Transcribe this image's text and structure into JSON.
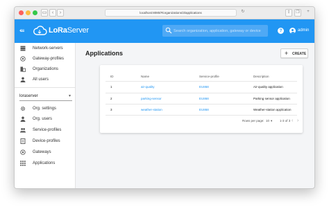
{
  "browser": {
    "url": "localhost:8080/#/organizations/3/applications"
  },
  "appbar": {
    "brand_bold": "LoRa",
    "brand_light": "Server",
    "search_placeholder": "Search organization, application, gateway or device",
    "user": "admin"
  },
  "sidebar": {
    "top_items": [
      {
        "label": "Network-servers",
        "icon": "server-icon"
      },
      {
        "label": "Gateway-profiles",
        "icon": "radio-tower-icon"
      },
      {
        "label": "Organizations",
        "icon": "domain-icon"
      },
      {
        "label": "All users",
        "icon": "person-icon"
      }
    ],
    "org_select": "loraserver",
    "org_items": [
      {
        "label": "Org. settings",
        "icon": "gear-icon"
      },
      {
        "label": "Org. users",
        "icon": "person-icon"
      },
      {
        "label": "Service-profiles",
        "icon": "people-icon"
      },
      {
        "label": "Device-profiles",
        "icon": "document-icon"
      },
      {
        "label": "Gateways",
        "icon": "radio-tower-icon"
      },
      {
        "label": "Applications",
        "icon": "apps-grid-icon"
      }
    ]
  },
  "main": {
    "title": "Applications",
    "create_label": "CREATE",
    "table": {
      "headers": [
        "ID",
        "Name",
        "Service-profile",
        "Description"
      ],
      "rows": [
        {
          "id": "1",
          "name": "air-quality",
          "service_profile": "EU868",
          "description": "Air-quality application"
        },
        {
          "id": "2",
          "name": "parking-sensor",
          "service_profile": "EU868",
          "description": "Parking sensor application"
        },
        {
          "id": "3",
          "name": "weather-station",
          "service_profile": "EU868",
          "description": "Weather-station application"
        }
      ]
    },
    "pagination": {
      "rows_per_page_label": "Rows per page:",
      "rows_per_page": "10",
      "range": "1-3 of 3"
    }
  },
  "colors": {
    "primary": "#2196f3",
    "link": "#2196f3"
  }
}
